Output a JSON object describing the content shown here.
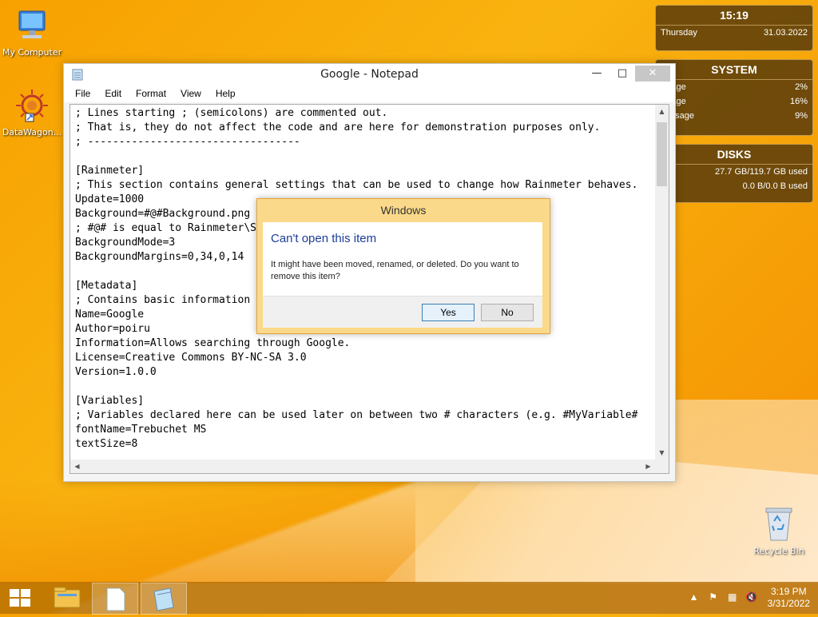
{
  "desktop": {
    "icons": [
      {
        "label": "My Computer"
      },
      {
        "label": "DataWagon..."
      },
      {
        "label": "Recycle Bin"
      }
    ]
  },
  "gadgets": {
    "clock": {
      "time": "15:19",
      "day": "Thursday",
      "date": "31.03.2022"
    },
    "system": {
      "title": "SYSTEM",
      "rows": [
        {
          "label": "Usage",
          "value": "2%"
        },
        {
          "label": "Usage",
          "value": "16%"
        },
        {
          "label": "P Usage",
          "value": "9%"
        }
      ]
    },
    "disks": {
      "title": "DISKS",
      "rows": [
        {
          "value": "27.7 GB/119.7 GB used"
        },
        {
          "value": "0.0 B/0.0 B used"
        }
      ]
    }
  },
  "notepad": {
    "title": "Google - Notepad",
    "menu": [
      "File",
      "Edit",
      "Format",
      "View",
      "Help"
    ],
    "lines": [
      "; Lines starting ; (semicolons) are commented out.",
      "; That is, they do not affect the code and are here for demonstration purposes only.",
      "; ----------------------------------",
      "",
      "[Rainmeter]",
      "; This section contains general settings that can be used to change how Rainmeter behaves.",
      "Update=1000",
      "Background=#@#Background.png",
      "; #@# is equal to Rainmeter\\S",
      "BackgroundMode=3",
      "BackgroundMargins=0,34,0,14",
      "",
      "[Metadata]",
      "; Contains basic information",
      "Name=Google",
      "Author=poiru",
      "Information=Allows searching through Google.",
      "License=Creative Commons BY-NC-SA 3.0",
      "Version=1.0.0",
      "",
      "[Variables]",
      "; Variables declared here can be used later on between two # characters (e.g. #MyVariable#",
      "fontName=Trebuchet MS",
      "textSize=8"
    ]
  },
  "dialog": {
    "title": "Windows",
    "heading": "Can't open this item",
    "message": "It might have been moved, renamed, or deleted. Do you want to remove this item?",
    "yes": "Yes",
    "no": "No"
  },
  "taskbar": {
    "time": "3:19 PM",
    "date": "3/31/2022"
  }
}
